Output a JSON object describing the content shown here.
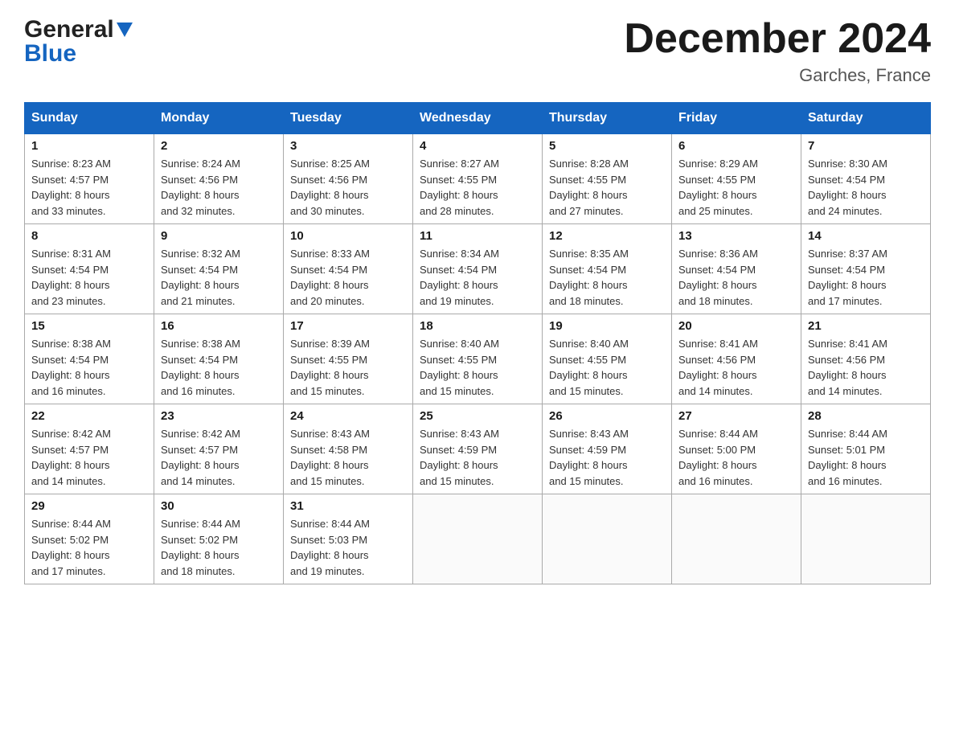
{
  "header": {
    "logo_general": "General",
    "logo_blue": "Blue",
    "month_title": "December 2024",
    "location": "Garches, France"
  },
  "weekdays": [
    "Sunday",
    "Monday",
    "Tuesday",
    "Wednesday",
    "Thursday",
    "Friday",
    "Saturday"
  ],
  "weeks": [
    [
      {
        "day": "1",
        "sunrise": "8:23 AM",
        "sunset": "4:57 PM",
        "daylight": "8 hours and 33 minutes."
      },
      {
        "day": "2",
        "sunrise": "8:24 AM",
        "sunset": "4:56 PM",
        "daylight": "8 hours and 32 minutes."
      },
      {
        "day": "3",
        "sunrise": "8:25 AM",
        "sunset": "4:56 PM",
        "daylight": "8 hours and 30 minutes."
      },
      {
        "day": "4",
        "sunrise": "8:27 AM",
        "sunset": "4:55 PM",
        "daylight": "8 hours and 28 minutes."
      },
      {
        "day": "5",
        "sunrise": "8:28 AM",
        "sunset": "4:55 PM",
        "daylight": "8 hours and 27 minutes."
      },
      {
        "day": "6",
        "sunrise": "8:29 AM",
        "sunset": "4:55 PM",
        "daylight": "8 hours and 25 minutes."
      },
      {
        "day": "7",
        "sunrise": "8:30 AM",
        "sunset": "4:54 PM",
        "daylight": "8 hours and 24 minutes."
      }
    ],
    [
      {
        "day": "8",
        "sunrise": "8:31 AM",
        "sunset": "4:54 PM",
        "daylight": "8 hours and 23 minutes."
      },
      {
        "day": "9",
        "sunrise": "8:32 AM",
        "sunset": "4:54 PM",
        "daylight": "8 hours and 21 minutes."
      },
      {
        "day": "10",
        "sunrise": "8:33 AM",
        "sunset": "4:54 PM",
        "daylight": "8 hours and 20 minutes."
      },
      {
        "day": "11",
        "sunrise": "8:34 AM",
        "sunset": "4:54 PM",
        "daylight": "8 hours and 19 minutes."
      },
      {
        "day": "12",
        "sunrise": "8:35 AM",
        "sunset": "4:54 PM",
        "daylight": "8 hours and 18 minutes."
      },
      {
        "day": "13",
        "sunrise": "8:36 AM",
        "sunset": "4:54 PM",
        "daylight": "8 hours and 18 minutes."
      },
      {
        "day": "14",
        "sunrise": "8:37 AM",
        "sunset": "4:54 PM",
        "daylight": "8 hours and 17 minutes."
      }
    ],
    [
      {
        "day": "15",
        "sunrise": "8:38 AM",
        "sunset": "4:54 PM",
        "daylight": "8 hours and 16 minutes."
      },
      {
        "day": "16",
        "sunrise": "8:38 AM",
        "sunset": "4:54 PM",
        "daylight": "8 hours and 16 minutes."
      },
      {
        "day": "17",
        "sunrise": "8:39 AM",
        "sunset": "4:55 PM",
        "daylight": "8 hours and 15 minutes."
      },
      {
        "day": "18",
        "sunrise": "8:40 AM",
        "sunset": "4:55 PM",
        "daylight": "8 hours and 15 minutes."
      },
      {
        "day": "19",
        "sunrise": "8:40 AM",
        "sunset": "4:55 PM",
        "daylight": "8 hours and 15 minutes."
      },
      {
        "day": "20",
        "sunrise": "8:41 AM",
        "sunset": "4:56 PM",
        "daylight": "8 hours and 14 minutes."
      },
      {
        "day": "21",
        "sunrise": "8:41 AM",
        "sunset": "4:56 PM",
        "daylight": "8 hours and 14 minutes."
      }
    ],
    [
      {
        "day": "22",
        "sunrise": "8:42 AM",
        "sunset": "4:57 PM",
        "daylight": "8 hours and 14 minutes."
      },
      {
        "day": "23",
        "sunrise": "8:42 AM",
        "sunset": "4:57 PM",
        "daylight": "8 hours and 14 minutes."
      },
      {
        "day": "24",
        "sunrise": "8:43 AM",
        "sunset": "4:58 PM",
        "daylight": "8 hours and 15 minutes."
      },
      {
        "day": "25",
        "sunrise": "8:43 AM",
        "sunset": "4:59 PM",
        "daylight": "8 hours and 15 minutes."
      },
      {
        "day": "26",
        "sunrise": "8:43 AM",
        "sunset": "4:59 PM",
        "daylight": "8 hours and 15 minutes."
      },
      {
        "day": "27",
        "sunrise": "8:44 AM",
        "sunset": "5:00 PM",
        "daylight": "8 hours and 16 minutes."
      },
      {
        "day": "28",
        "sunrise": "8:44 AM",
        "sunset": "5:01 PM",
        "daylight": "8 hours and 16 minutes."
      }
    ],
    [
      {
        "day": "29",
        "sunrise": "8:44 AM",
        "sunset": "5:02 PM",
        "daylight": "8 hours and 17 minutes."
      },
      {
        "day": "30",
        "sunrise": "8:44 AM",
        "sunset": "5:02 PM",
        "daylight": "8 hours and 18 minutes."
      },
      {
        "day": "31",
        "sunrise": "8:44 AM",
        "sunset": "5:03 PM",
        "daylight": "8 hours and 19 minutes."
      },
      null,
      null,
      null,
      null
    ]
  ],
  "labels": {
    "sunrise": "Sunrise:",
    "sunset": "Sunset:",
    "daylight": "Daylight:"
  }
}
